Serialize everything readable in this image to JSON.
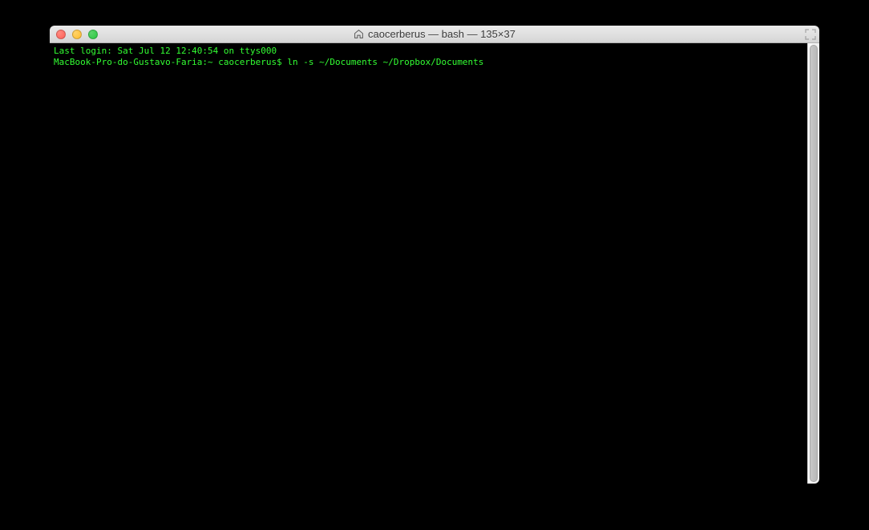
{
  "window": {
    "title": "caocerberus — bash — 135×37"
  },
  "terminal": {
    "lines": [
      "Last login: Sat Jul 12 12:40:54 on ttys000",
      "MacBook-Pro-do-Gustavo-Faria:~ caocerberus$ ln -s ~/Documents ~/Dropbox/Documents"
    ]
  }
}
